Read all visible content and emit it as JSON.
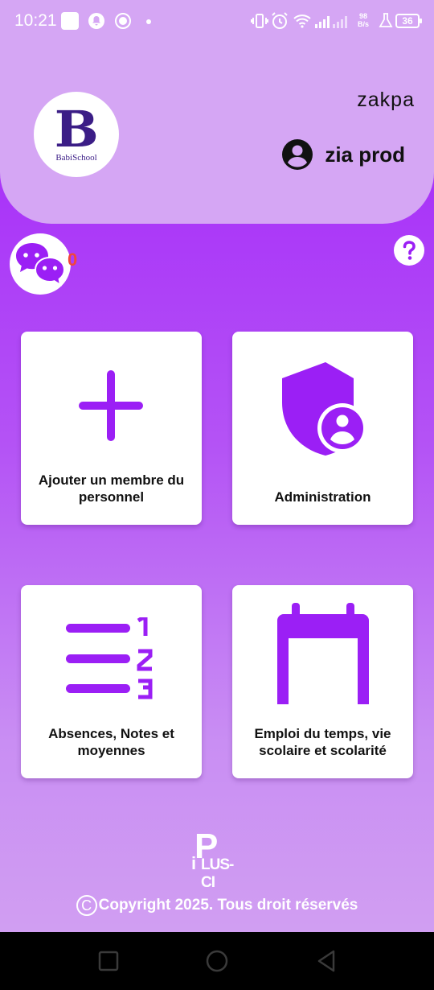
{
  "status_bar": {
    "time": "10:21",
    "net_speed_value": "98",
    "net_speed_unit": "B/s",
    "battery": "36"
  },
  "header": {
    "logo_letter": "B",
    "logo_text": "BabiSchool",
    "user_first_name": "zakpa",
    "user_name": "zia prod"
  },
  "chat": {
    "unread_count": "0"
  },
  "cards": [
    {
      "label": "Ajouter un membre du personnel",
      "icon": "plus-icon"
    },
    {
      "label": "Administration",
      "icon": "shield-user-icon"
    },
    {
      "label": "Absences, Notes et moyennes",
      "icon": "numbered-list-icon"
    },
    {
      "label": "Emploi du temps, vie scolaire et scolarité",
      "icon": "calendar-icon"
    }
  ],
  "brand": {
    "letter_p": "P",
    "letter_i": "i",
    "rest": "LUS-CI"
  },
  "footer": {
    "copyright_symbol": "C",
    "copyright_text": "Copyright 2025. Tous droit réservés"
  },
  "colors": {
    "accent": "#9b1ff5",
    "header_bg": "#d5a6f4",
    "logo": "#3b1d86",
    "badge": "#f1463b"
  }
}
